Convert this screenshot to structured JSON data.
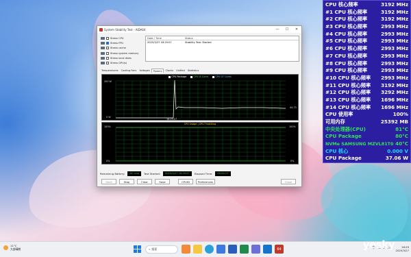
{
  "window": {
    "title": "System Stability Test - AIDA64",
    "minimize": "—",
    "maximize": "☐",
    "close": "✕"
  },
  "stress_options": [
    {
      "label": "Stress CPU",
      "checked": false
    },
    {
      "label": "Stress FPU",
      "checked": true
    },
    {
      "label": "Stress cache",
      "checked": false
    },
    {
      "label": "Stress system memory",
      "checked": false
    },
    {
      "label": "Stress local disks",
      "checked": false
    },
    {
      "label": "Stress GPU(s)",
      "checked": false
    }
  ],
  "log": {
    "headers": [
      "Date / Time",
      "Status"
    ],
    "rows": [
      {
        "datetime": "2025/3/27 16:29:07",
        "status": "Stability Test: Started"
      }
    ]
  },
  "tabs": [
    "Temperatures",
    "Cooling Fans",
    "Voltages",
    "Powers",
    "Clocks",
    "Unified",
    "Statistics"
  ],
  "active_tab": "Powers",
  "graph_top": {
    "legend": [
      "CPU Package",
      "CPU IA Cores",
      "CPU GT Cores"
    ],
    "y_max_label": "200 W",
    "y_min_label": "0 W",
    "x_label": "16:29:07",
    "value_label": "44.73",
    "colors": {
      "package": "#ffffff",
      "ia_cores": "#4cd24c",
      "gt_cores": "#49c8ff",
      "grid": "#0d5a14"
    }
  },
  "graph_bottom": {
    "title": "CPU Usage | CPU Throttling",
    "y_max_label": "100%",
    "y_min_label": "0%",
    "right_max_label": "100%",
    "right_min_label": "0%",
    "colors": {
      "title": "#ffd21a",
      "usage": "#3ec53e",
      "grid": "#0d5a14"
    }
  },
  "status_bar": {
    "battery_label": "Remaining Battery:",
    "battery_value": "AC Line",
    "started_label": "Test Started:",
    "started_value": "2025/3/27 16:29:07",
    "elapsed_label": "Elapsed Time:",
    "elapsed_value": "00:00:27"
  },
  "buttons": [
    "Start",
    "Stop",
    "Clear",
    "Save",
    "CPUID",
    "Preferences",
    "Close"
  ],
  "monitor": [
    {
      "label": "CPU 核心频率",
      "value": "3192 MHz",
      "style": "white"
    },
    {
      "label": "#1 CPU 核心频率",
      "value": "3192 MHz",
      "style": "white"
    },
    {
      "label": "#2 CPU 核心频率",
      "value": "3192 MHz",
      "style": "white"
    },
    {
      "label": "#3 CPU 核心频率",
      "value": "2993 MHz",
      "style": "white"
    },
    {
      "label": "#4 CPU 核心频率",
      "value": "2993 MHz",
      "style": "white"
    },
    {
      "label": "#5 CPU 核心频率",
      "value": "2993 MHz",
      "style": "white"
    },
    {
      "label": "#6 CPU 核心频率",
      "value": "2993 MHz",
      "style": "white"
    },
    {
      "label": "#7 CPU 核心频率",
      "value": "2993 MHz",
      "style": "white"
    },
    {
      "label": "#8 CPU 核心频率",
      "value": "2993 MHz",
      "style": "white"
    },
    {
      "label": "#9 CPU 核心频率",
      "value": "2993 MHz",
      "style": "white"
    },
    {
      "label": "#10 CPU 核心频率",
      "value": "2993 MHz",
      "style": "white"
    },
    {
      "label": "#11 CPU 核心频率",
      "value": "3192 MHz",
      "style": "white"
    },
    {
      "label": "#12 CPU 核心频率",
      "value": "3292 MHz",
      "style": "white"
    },
    {
      "label": "#13 CPU 核心频率",
      "value": "1696 MHz",
      "style": "white"
    },
    {
      "label": "#14 CPU 核心频率",
      "value": "1696 MHz",
      "style": "white"
    },
    {
      "label": "CPU 使用率",
      "value": "100%",
      "style": "white"
    },
    {
      "label": "可用内存",
      "value": "25392 MB",
      "style": "white"
    },
    {
      "label": "中央处理器(CPU)",
      "value": "81°C",
      "style": "green"
    },
    {
      "label": "CPU Package",
      "value": "80°C",
      "style": "green"
    },
    {
      "label": "NVMe SAMSUNG MZVL81T0",
      "value": "40°C",
      "style": "green"
    },
    {
      "label": "CPU 核心",
      "value": "0.000 V",
      "style": "cyan"
    },
    {
      "label": "CPU Package",
      "value": "37.06 W",
      "style": "white"
    }
  ],
  "taskbar": {
    "weather_temp": "11°C",
    "weather_desc": "大部晴朗",
    "search_placeholder": "搜索",
    "time": "16:29",
    "date": "2025/3/27",
    "tray_lang": "中",
    "apps": [
      "start-icon",
      "search-field",
      "widgets-icon",
      "file-explorer-icon",
      "edge-icon",
      "store-icon",
      "word-icon",
      "excel-icon",
      "photos-icon",
      "mail-icon",
      "aida64-icon"
    ],
    "aida_label": "64"
  },
  "watermark": "yesky"
}
